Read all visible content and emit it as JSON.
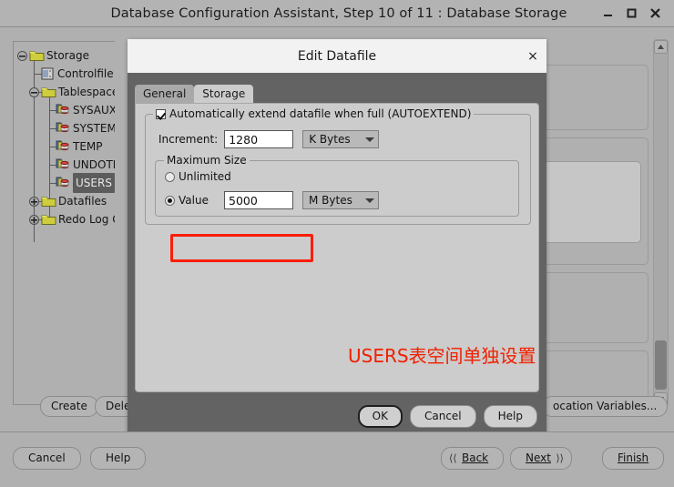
{
  "window": {
    "title": "Database Configuration Assistant, Step 10 of 11 : Database Storage",
    "minimize_label": "minimize",
    "maximize_label": "maximize",
    "close_label": "close"
  },
  "tree": {
    "nodes": [
      {
        "label": "Storage",
        "icon": "folder-icon",
        "toggle": "collapse",
        "depth": 0,
        "selected": false
      },
      {
        "label": "Controlfile",
        "icon": "controlfile-icon",
        "toggle": "none",
        "depth": 1,
        "selected": false
      },
      {
        "label": "Tablespaces",
        "icon": "folder-icon",
        "toggle": "collapse",
        "depth": 1,
        "selected": false
      },
      {
        "label": "SYSAUX",
        "icon": "tablespace-icon",
        "toggle": "none",
        "depth": 2,
        "selected": false
      },
      {
        "label": "SYSTEM",
        "icon": "tablespace-icon",
        "toggle": "none",
        "depth": 2,
        "selected": false
      },
      {
        "label": "TEMP",
        "icon": "tablespace-icon",
        "toggle": "none",
        "depth": 2,
        "selected": false
      },
      {
        "label": "UNDOTBS",
        "icon": "tablespace-icon",
        "toggle": "none",
        "depth": 2,
        "selected": false
      },
      {
        "label": "USERS",
        "icon": "tablespace-icon",
        "toggle": "none",
        "depth": 2,
        "selected": true
      },
      {
        "label": "Datafiles",
        "icon": "folder-icon",
        "toggle": "expand",
        "depth": 1,
        "selected": false
      },
      {
        "label": "Redo Log Gro",
        "icon": "folder-icon",
        "toggle": "expand",
        "depth": 1,
        "selected": false
      }
    ]
  },
  "main_buttons": {
    "create": "Create",
    "delete": "Delet",
    "location_variables": "ocation Variables..."
  },
  "wizard_buttons": {
    "cancel": "Cancel",
    "help": "Help",
    "back": "Back",
    "back_mnemonic": "B",
    "next": "Next",
    "next_mnemonic": "N",
    "finish": "Finish",
    "finish_mnemonic": "F"
  },
  "dialog": {
    "title": "Edit Datafile",
    "close_label": "×",
    "tabs": [
      {
        "label": "General",
        "active": false
      },
      {
        "label": "Storage",
        "active": true
      }
    ],
    "autoextend": {
      "checkbox_label": "Automatically extend datafile when full (AUTOEXTEND)",
      "checked": true,
      "increment_label": "Increment:",
      "increment_value": "1280",
      "increment_unit": "K Bytes"
    },
    "maximum_size": {
      "legend": "Maximum Size",
      "unlimited_label": "Unlimited",
      "unlimited_selected": false,
      "value_label": "Value",
      "value_selected": true,
      "value": "5000",
      "value_unit": "M Bytes"
    },
    "buttons": {
      "ok": "OK",
      "cancel": "Cancel",
      "help": "Help"
    }
  },
  "annotation": {
    "text": "USERS表空间单独设置",
    "color": "#f02000"
  }
}
